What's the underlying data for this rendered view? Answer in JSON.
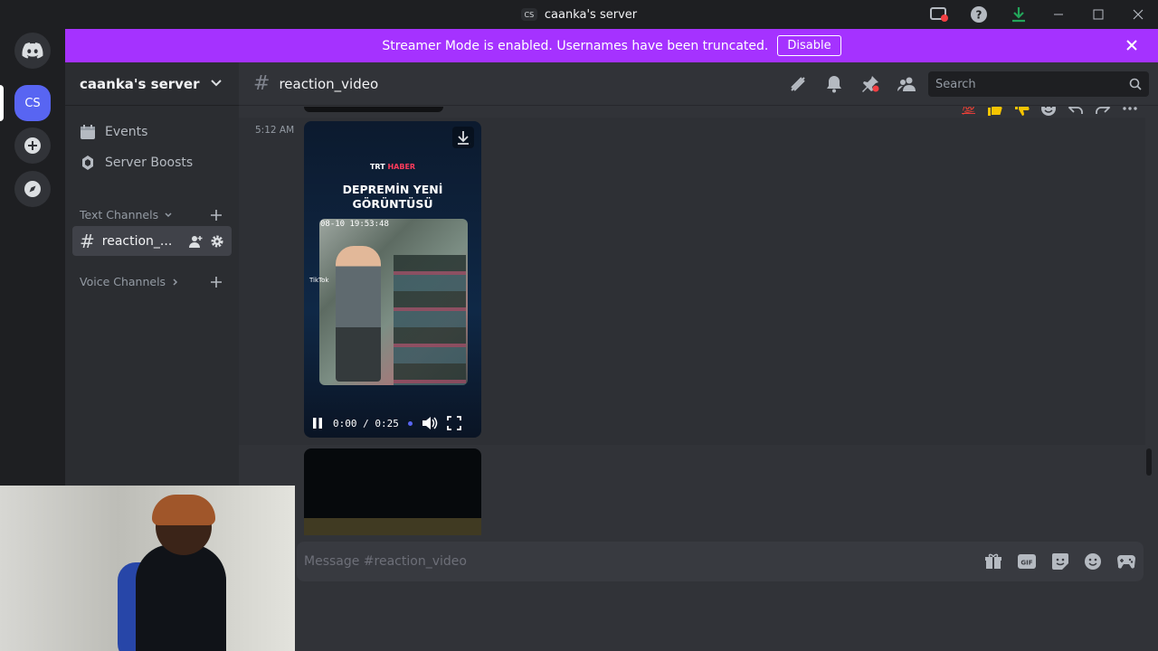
{
  "window": {
    "title": "caanka's server",
    "title_badge": "CS"
  },
  "banner": {
    "text": "Streamer Mode is enabled. Usernames have been truncated.",
    "button": "Disable",
    "color": "#a532ff"
  },
  "rail": {
    "server_abbrev": "CS"
  },
  "sidebar": {
    "server_name": "caanka's server",
    "events_label": "Events",
    "boosts_label": "Server Boosts",
    "text_category": "Text Channels",
    "active_channel": "reaction_...",
    "voice_category": "Voice Channels"
  },
  "channel": {
    "name": "reaction_video",
    "search_placeholder": "Search"
  },
  "message": {
    "timestamp": "5:12 AM",
    "video": {
      "brand_trt": "TRT",
      "brand_haber": "HABER",
      "headline_line1": "DEPREMİN YENİ",
      "headline_line2": "GÖRÜNTÜSÜ",
      "overlay_timestamp": "08-10 19:53:48",
      "watermark": "TikTok",
      "time_display": "0:00 / 0:25"
    }
  },
  "composer": {
    "placeholder": "Message #reaction_video"
  },
  "colors": {
    "accent": "#5865f2",
    "bg_main": "#313338",
    "bg_sidebar": "#2b2d31",
    "bg_rail": "#1e1f22"
  }
}
